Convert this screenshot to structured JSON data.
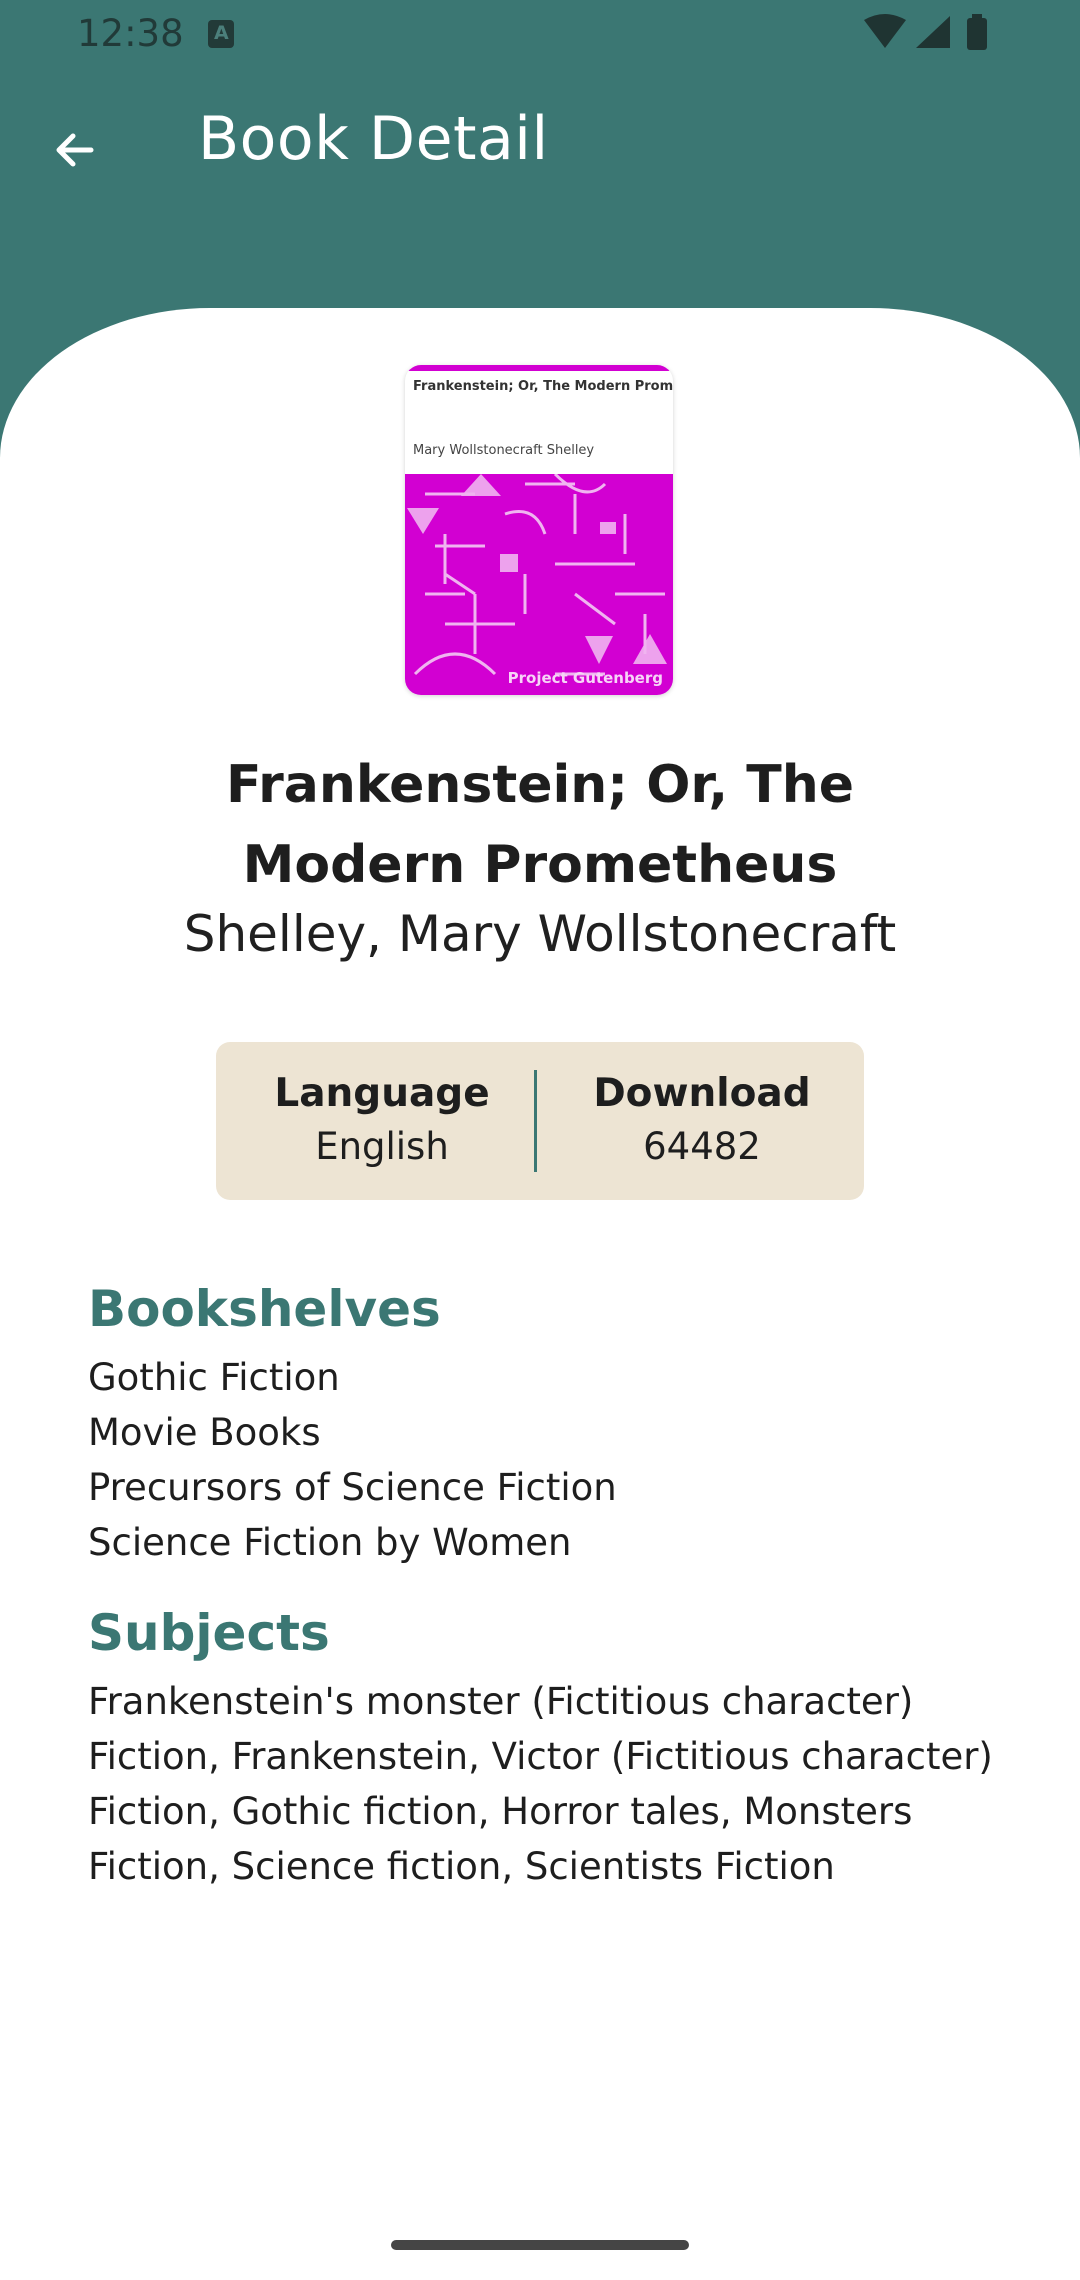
{
  "status_bar": {
    "time": "12:38",
    "icons": [
      "app-notification-icon",
      "wifi-icon",
      "signal-icon",
      "battery-icon"
    ]
  },
  "toolbar": {
    "title": "Book Detail",
    "back_icon": "arrow-back-icon"
  },
  "book": {
    "cover": {
      "title": "Frankenstein; Or, The Modern Prometheus",
      "author": "Mary Wollstonecraft Shelley",
      "publisher": "Project Gutenberg"
    },
    "title": "Frankenstein; Or, The Modern Prometheus",
    "author": "Shelley, Mary Wollstonecraft",
    "language_label": "Language",
    "language_value": "English",
    "download_label": "Download",
    "download_value": "64482"
  },
  "bookshelves": {
    "heading": "Bookshelves",
    "items": [
      "Gothic Fiction",
      "Movie Books",
      "Precursors of Science Fiction",
      "Science Fiction by Women"
    ]
  },
  "subjects": {
    "heading": "Subjects",
    "items": [
      "Frankenstein's monster (Fictitious character)",
      "Fiction, Frankenstein, Victor (Fictitious character)",
      "Fiction, Gothic fiction, Horror tales, Monsters",
      "Fiction, Science fiction, Scientists Fiction"
    ]
  },
  "colors": {
    "primary": "#3b7773",
    "info_box": "#ede4d3",
    "cover_accent": "#d200d2"
  }
}
